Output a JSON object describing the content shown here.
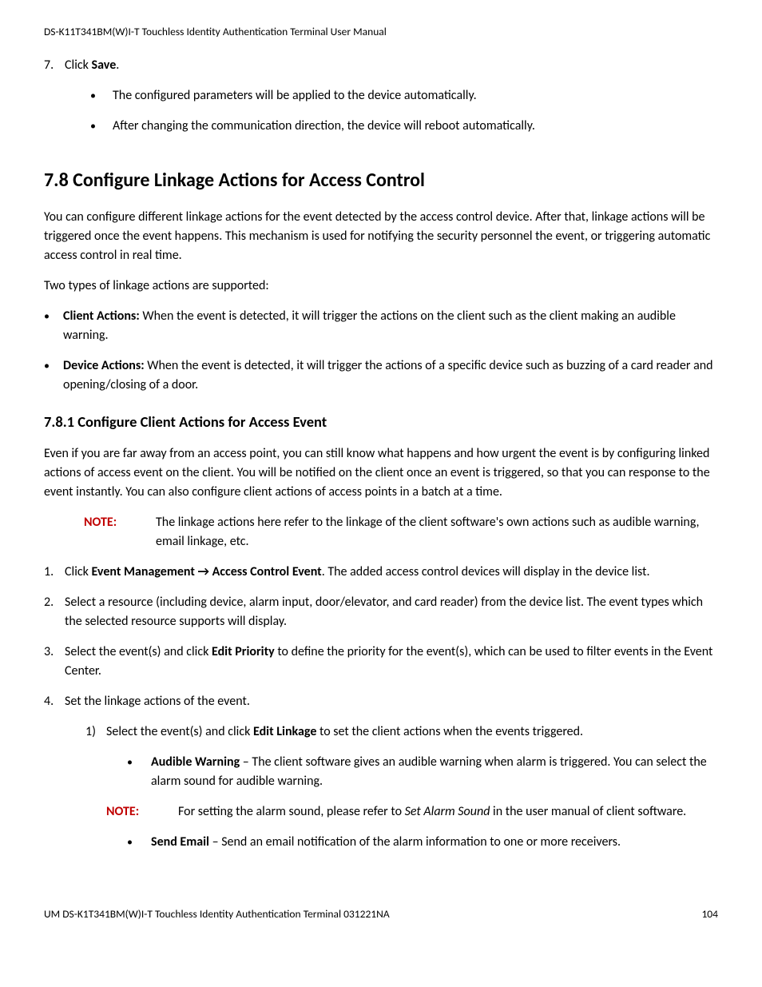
{
  "header": {
    "text": "DS-K11T341BM(W)I-T Touchless Identity Authentication Terminal User Manual"
  },
  "step7": {
    "num": "7.",
    "prefix": "Click ",
    "bold": "Save",
    "suffix": ".",
    "bullets": [
      "The configured parameters will be applied to the device automatically.",
      "After changing the communication direction, the device will reboot automatically."
    ]
  },
  "section78": {
    "title": "7.8 Configure Linkage Actions for Access Control",
    "para1": "You can configure different linkage actions for the event detected by the access control device. After that, linkage actions will be triggered once the event happens. This mechanism is used for notifying the security personnel the event, or triggering automatic access control in real time.",
    "para2": "Two types of linkage actions are supported:",
    "actions": [
      {
        "bold": "Client Actions:",
        "text": " When the event is detected, it will trigger the actions on the client such as the client making an audible warning."
      },
      {
        "bold": "Device Actions:",
        "text": " When the event is detected, it will trigger the actions of a specific device such as buzzing of a card reader and opening/closing of a door."
      }
    ]
  },
  "section781": {
    "title": "7.8.1 Configure Client Actions for Access Event",
    "para": "Even if you are far away from an access point, you can still know what happens and how urgent the event is by configuring linked actions of access event on the client. You will be notified on the client once an event is triggered, so that you can response to the event instantly. You can also configure client actions of access points in a batch at a time.",
    "note": {
      "label": "NOTE:",
      "text": "The linkage actions here refer to the linkage of the client software's own actions such as audible warning, email linkage, etc."
    },
    "step1": {
      "num": "1.",
      "pre": "Click ",
      "b1": "Event Management → Access Control Event",
      "post": ". The added access control devices will display in the device list."
    },
    "step2": {
      "num": "2.",
      "text": "Select a resource (including device, alarm input, door/elevator, and card reader) from the device list. The event types which the selected resource supports will display."
    },
    "step3": {
      "num": "3.",
      "pre": "Select the event(s) and click ",
      "b1": "Edit Priority",
      "post": " to define the priority for the event(s), which can be used to filter events in the Event Center."
    },
    "step4": {
      "num": "4.",
      "text": "Set the linkage actions of the event.",
      "sub1": {
        "num": "1)",
        "pre": "Select the event(s) and click ",
        "b1": "Edit Linkage",
        "post": " to set the client actions when the events triggered."
      },
      "audible": {
        "bold": "Audible Warning",
        "text": " – The client software gives an audible warning when alarm is triggered. You can select the alarm sound for audible warning."
      },
      "note2": {
        "label": "NOTE:",
        "pre": "For setting the alarm sound, please refer to ",
        "italic": "Set Alarm Sound",
        "post": " in the user manual of client software."
      },
      "email": {
        "bold": "Send Email",
        "text": " – Send an email notification of the alarm information to one or more receivers."
      }
    }
  },
  "footer": {
    "left": "UM DS-K1T341BM(W)I-T Touchless Identity Authentication Terminal 031221NA",
    "right": "104"
  }
}
